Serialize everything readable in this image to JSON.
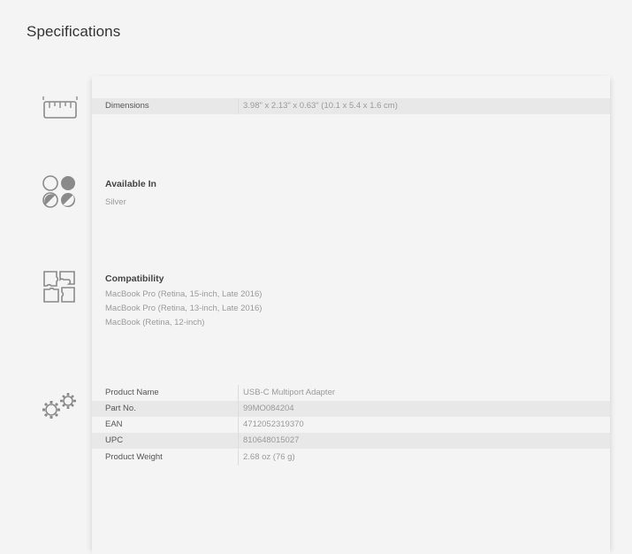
{
  "page": {
    "title": "Specifications"
  },
  "dimensions": {
    "icon": "ruler-icon",
    "label": "Dimensions",
    "value": "3.98\" x 2.13\" x 0.63\" (10.1 x 5.4 x 1.6 cm)"
  },
  "available": {
    "icon": "color-swatches-icon",
    "title": "Available In",
    "items": [
      "Silver"
    ]
  },
  "compatibility": {
    "icon": "puzzle-icon",
    "title": "Compatibility",
    "items": [
      "MacBook Pro (Retina, 15-inch, Late 2016)",
      "MacBook Pro (Retina, 13-inch, Late 2016)",
      "MacBook (Retina, 12-inch)"
    ]
  },
  "details": {
    "icon": "gears-icon",
    "rows": [
      {
        "label": "Product Name",
        "value": "USB-C Multiport Adapter"
      },
      {
        "label": "Part No.",
        "value": "99MO084204"
      },
      {
        "label": "EAN",
        "value": "4712052319370"
      },
      {
        "label": "UPC",
        "value": "810648015027"
      },
      {
        "label": "Product Weight",
        "value": "2.68 oz (76 g)"
      }
    ]
  }
}
